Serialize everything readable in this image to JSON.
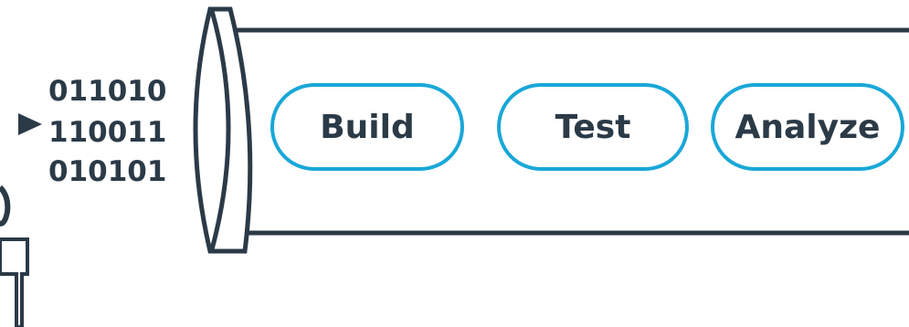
{
  "binary_input": {
    "lines": [
      "011010",
      "110011",
      "010101"
    ]
  },
  "pipeline": {
    "stages": [
      {
        "label": "Build"
      },
      {
        "label": "Test"
      },
      {
        "label": "Analyze"
      }
    ]
  },
  "colors": {
    "outline": "#2b3a47",
    "stage_border": "#19a7d8",
    "text": "#2b3a47"
  },
  "icons": [
    "arrow-right-icon",
    "plug-connector-icon"
  ]
}
